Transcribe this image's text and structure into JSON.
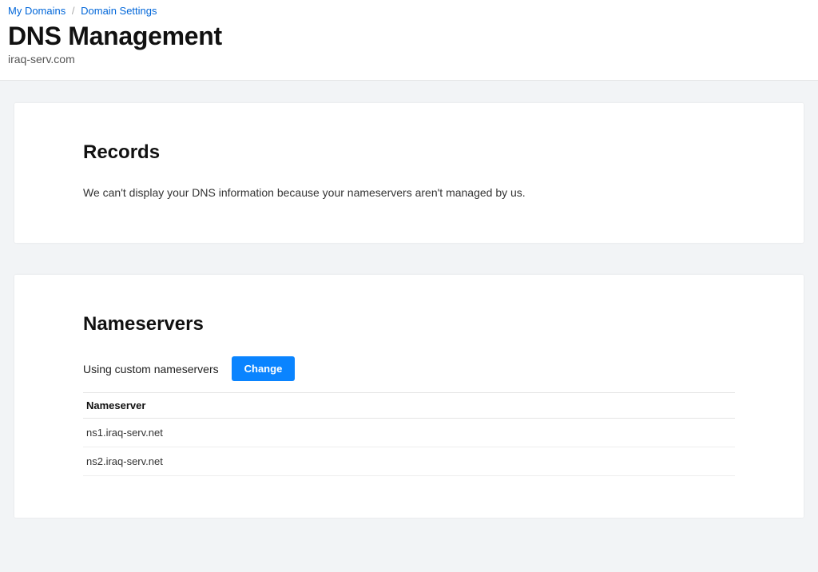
{
  "breadcrumb": {
    "my_domains": "My Domains",
    "domain_settings": "Domain Settings"
  },
  "page": {
    "title": "DNS Management",
    "domain": "iraq-serv.com"
  },
  "records": {
    "heading": "Records",
    "message": "We can't display your DNS information because your nameservers aren't managed by us."
  },
  "nameservers": {
    "heading": "Nameservers",
    "status_text": "Using custom nameservers",
    "change_button": "Change",
    "column_header": "Nameserver",
    "list": [
      "ns1.iraq-serv.net",
      "ns2.iraq-serv.net"
    ]
  }
}
